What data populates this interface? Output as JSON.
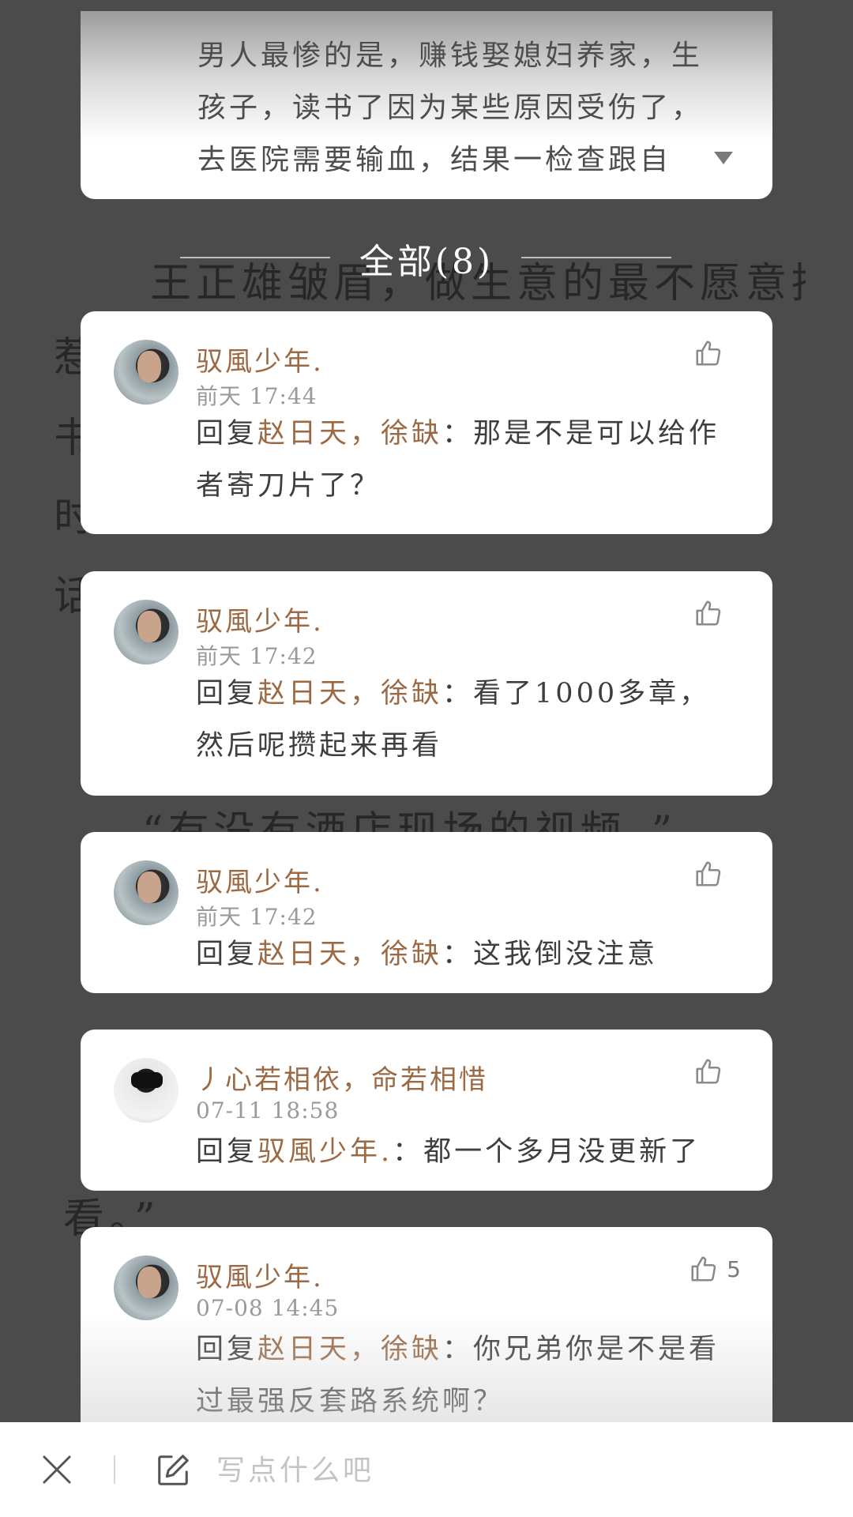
{
  "background_text": {
    "lines": [
      "王正雄皱眉，做生意的最不愿意招",
      "惹",
      "书",
      "时",
      "话",
      "“有没有酒店现场的视频。”",
      "看。”"
    ]
  },
  "top_card": {
    "text": "男人最惨的是，赚钱娶媳妇养家，生孩子，读书了因为某些原因受伤了，去医院需要输血，结果一检查跟自"
  },
  "section": {
    "title": "全部(8)"
  },
  "comments": [
    {
      "username": "驭風少年.",
      "time": "前天 17:44",
      "reply_prefix": "回复",
      "reply_target": "赵日天，徐缺",
      "reply_text": "：那是不是可以给作者寄刀片了？",
      "likes": ""
    },
    {
      "username": "驭風少年.",
      "time": "前天 17:42",
      "reply_prefix": "回复",
      "reply_target": "赵日天，徐缺",
      "reply_text": "：看了1000多章，然后呢攒起来再看",
      "likes": ""
    },
    {
      "username": "驭風少年.",
      "time": "前天 17:42",
      "reply_prefix": "回复",
      "reply_target": "赵日天，徐缺",
      "reply_text": "：这我倒没注意",
      "likes": ""
    },
    {
      "username": "丿心若相依，命若相惜",
      "time": "07-11 18:58",
      "reply_prefix": "回复",
      "reply_target": "驭風少年.",
      "reply_text": "：都一个多月没更新了",
      "likes": ""
    },
    {
      "username": "驭風少年.",
      "time": "07-08 14:45",
      "reply_prefix": "回复",
      "reply_target": "赵日天，徐缺",
      "reply_text": "：你兄弟你是不是看过最强反套路系统啊？",
      "likes": "5"
    }
  ],
  "input_bar": {
    "placeholder": "写点什么吧"
  },
  "icons": {
    "like": "thumbs-up-icon",
    "close": "close-icon",
    "edit": "edit-icon",
    "expand": "chevron-down-icon"
  },
  "colors": {
    "username": "#9b6a45",
    "overlay": "#4b4b4b",
    "card": "#ffffff"
  }
}
